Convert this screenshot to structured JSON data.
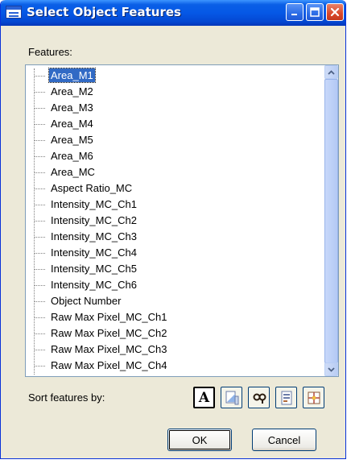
{
  "window": {
    "title": "Select Object Features",
    "colors": {
      "titlebar": "#0558e6",
      "body": "#ece9d8",
      "selection": "#316ac5",
      "close": "#d9482a"
    }
  },
  "features_label": "Features:",
  "features": [
    "Area_M1",
    "Area_M2",
    "Area_M3",
    "Area_M4",
    "Area_M5",
    "Area_M6",
    "Area_MC",
    "Aspect Ratio_MC",
    "Intensity_MC_Ch1",
    "Intensity_MC_Ch2",
    "Intensity_MC_Ch3",
    "Intensity_MC_Ch4",
    "Intensity_MC_Ch5",
    "Intensity_MC_Ch6",
    "Object Number",
    "Raw Max Pixel_MC_Ch1",
    "Raw Max Pixel_MC_Ch2",
    "Raw Max Pixel_MC_Ch3",
    "Raw Max Pixel_MC_Ch4"
  ],
  "selected_feature": "Area_M1",
  "sort_label": "Sort features by:",
  "sort_buttons": [
    {
      "icon": "alphabetical-sort-icon",
      "glyph": "A"
    },
    {
      "icon": "feature-type-sort-icon"
    },
    {
      "icon": "mask-sort-icon"
    },
    {
      "icon": "channel-sort-icon"
    },
    {
      "icon": "grid-sort-icon"
    }
  ],
  "buttons": {
    "ok": "OK",
    "cancel": "Cancel"
  }
}
